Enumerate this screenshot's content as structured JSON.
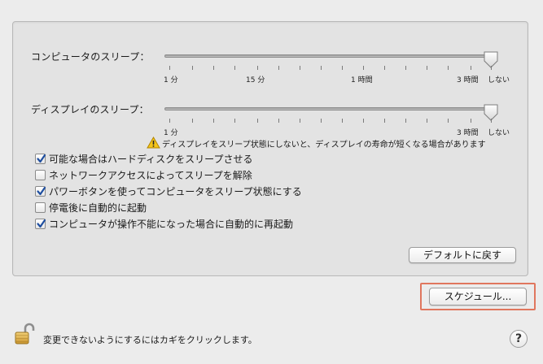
{
  "computer_sleep": {
    "label": "コンピュータのスリープ：",
    "ticks": {
      "t1": "1 分",
      "t15": "15 分",
      "t1h": "1 時間",
      "t3h": "3 時間",
      "never": "しない"
    },
    "value": "しない"
  },
  "display_sleep": {
    "label": "ディスプレイのスリープ：",
    "ticks": {
      "t1": "1 分",
      "t3h": "3 時間",
      "never": "しない"
    },
    "value": "しない"
  },
  "warning": "ディスプレイをスリープ状態にしないと、ディスプレイの寿命が短くなる場合があります",
  "options": [
    {
      "label": "可能な場合はハードディスクをスリープさせる",
      "checked": true
    },
    {
      "label": "ネットワークアクセスによってスリープを解除",
      "checked": false
    },
    {
      "label": "パワーボタンを使ってコンピュータをスリープ状態にする",
      "checked": true
    },
    {
      "label": "停電後に自動的に起動",
      "checked": false
    },
    {
      "label": "コンピュータが操作不能になった場合に自動的に再起動",
      "checked": true
    }
  ],
  "buttons": {
    "restore_defaults": "デフォルトに戻す",
    "schedule": "スケジュール..."
  },
  "lock": {
    "text": "変更できないようにするにはカギをクリックします。"
  },
  "help": {
    "label": "?"
  }
}
